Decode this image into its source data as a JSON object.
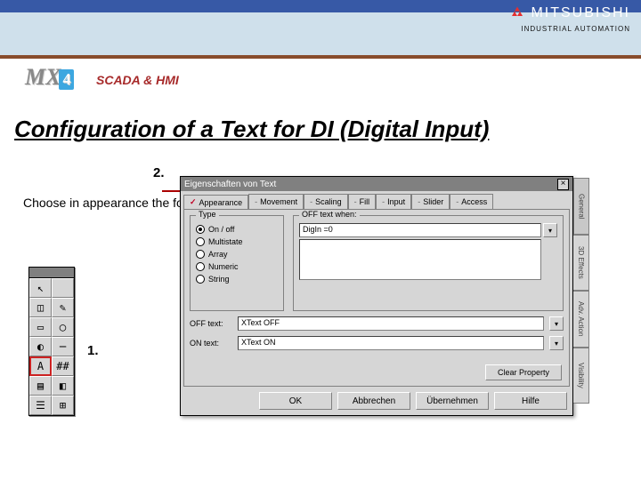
{
  "header": {
    "brand_name": "MITSUBISHI",
    "brand_sub": "INDUSTRIAL AUTOMATION",
    "product_logo_text": "MX",
    "product_logo_num": "4",
    "product_label": "SCADA & HMI"
  },
  "page": {
    "title": "Configuration of a Text for DI (Digital Input)",
    "instruction": "Choose in appearance the format of the text!",
    "step1": "1.",
    "step2": "2."
  },
  "palette": {
    "cells": [
      {
        "icon": "↖",
        "name": "pointer-tool"
      },
      {
        "icon": " ",
        "name": "blank-tool"
      },
      {
        "icon": "◫",
        "name": "panel-tool"
      },
      {
        "icon": "✎",
        "name": "pencil-tool"
      },
      {
        "icon": "▭",
        "name": "rect-tool"
      },
      {
        "icon": "◯",
        "name": "ellipse-tool"
      },
      {
        "icon": "◐",
        "name": "arc-tool"
      },
      {
        "icon": "─",
        "name": "line-tool"
      },
      {
        "icon": "A",
        "name": "text-tool",
        "selected": true
      },
      {
        "icon": "##",
        "name": "number-tool"
      },
      {
        "icon": "▤",
        "name": "button-tool"
      },
      {
        "icon": "◧",
        "name": "symbol-tool"
      },
      {
        "icon": "☰",
        "name": "trend-tool"
      },
      {
        "icon": "⊞",
        "name": "grid-tool"
      }
    ]
  },
  "dialog": {
    "title": "Eigenschaften von Text",
    "close": "×",
    "tabs": [
      {
        "label": "Appearance",
        "marker": "✓",
        "active": true
      },
      {
        "label": "Movement",
        "marker": "-"
      },
      {
        "label": "Scaling",
        "marker": "-"
      },
      {
        "label": "Fill",
        "marker": "-"
      },
      {
        "label": "Input",
        "marker": "-"
      },
      {
        "label": "Slider",
        "marker": "-"
      },
      {
        "label": "Access",
        "marker": "-"
      }
    ],
    "type_group_label": "Type",
    "type_options": [
      {
        "label": "On / off",
        "checked": true
      },
      {
        "label": "Multistate",
        "checked": false
      },
      {
        "label": "Array",
        "checked": false
      },
      {
        "label": "Numeric",
        "checked": false
      },
      {
        "label": "String",
        "checked": false
      }
    ],
    "offwhen_group_label": "OFF text when:",
    "offwhen_value": "DigIn =0",
    "off_text_label": "OFF text:",
    "off_text_value": "XText OFF",
    "on_text_label": "ON text:",
    "on_text_value": "XText ON",
    "side_btn_label": "▾",
    "clear_property": "Clear Property",
    "buttons": {
      "ok": "OK",
      "cancel": "Abbrechen",
      "apply": "Übernehmen",
      "help": "Hilfe"
    },
    "side_tabs": [
      "General",
      "3D Effects",
      "Adv. Action",
      "Visibility"
    ]
  }
}
